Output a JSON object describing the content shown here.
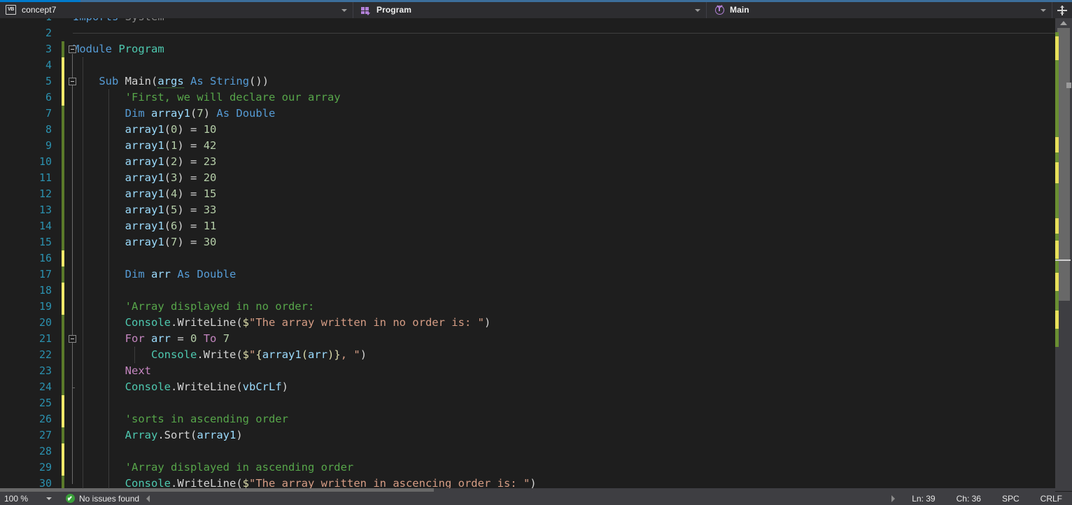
{
  "window": {
    "accent_color": "#007acc",
    "background": "#1e1e1e"
  },
  "nav_bar": {
    "project": {
      "label": "concept7",
      "icon": "vb-file-icon",
      "caret": "chevron-down-icon"
    },
    "type": {
      "label": "Program",
      "icon": "module-icon",
      "caret": "chevron-down-icon"
    },
    "member": {
      "label": "Main",
      "icon": "method-icon",
      "caret": "chevron-down-icon"
    },
    "split_button": "split-view-icon"
  },
  "editor": {
    "language": "Visual Basic",
    "lines": [
      {
        "n": "1",
        "indent": 0,
        "change": "none",
        "fold": "none",
        "text": "Imports System"
      },
      {
        "n": "2",
        "indent": 0,
        "change": "none",
        "fold": "none",
        "text": ""
      },
      {
        "n": "3",
        "indent": 0,
        "change": "saved",
        "fold": "open",
        "text": "Module Program"
      },
      {
        "n": "4",
        "indent": 1,
        "change": "unsaved",
        "fold": "none",
        "text": ""
      },
      {
        "n": "5",
        "indent": 1,
        "change": "unsaved",
        "fold": "open",
        "text": "    Sub Main(args As String())"
      },
      {
        "n": "6",
        "indent": 2,
        "change": "unsaved",
        "fold": "none",
        "text": "        'First, we will declare our array"
      },
      {
        "n": "7",
        "indent": 2,
        "change": "saved",
        "fold": "none",
        "text": "        Dim array1(7) As Double"
      },
      {
        "n": "8",
        "indent": 2,
        "change": "saved",
        "fold": "none",
        "text": "        array1(0) = 10"
      },
      {
        "n": "9",
        "indent": 2,
        "change": "saved",
        "fold": "none",
        "text": "        array1(1) = 42"
      },
      {
        "n": "10",
        "indent": 2,
        "change": "saved",
        "fold": "none",
        "text": "        array1(2) = 23"
      },
      {
        "n": "11",
        "indent": 2,
        "change": "saved",
        "fold": "none",
        "text": "        array1(3) = 20"
      },
      {
        "n": "12",
        "indent": 2,
        "change": "saved",
        "fold": "none",
        "text": "        array1(4) = 15"
      },
      {
        "n": "13",
        "indent": 2,
        "change": "saved",
        "fold": "none",
        "text": "        array1(5) = 33"
      },
      {
        "n": "14",
        "indent": 2,
        "change": "saved",
        "fold": "none",
        "text": "        array1(6) = 11"
      },
      {
        "n": "15",
        "indent": 2,
        "change": "saved",
        "fold": "none",
        "text": "        array1(7) = 30"
      },
      {
        "n": "16",
        "indent": 2,
        "change": "unsaved",
        "fold": "none",
        "text": ""
      },
      {
        "n": "17",
        "indent": 2,
        "change": "saved",
        "fold": "none",
        "text": "        Dim arr As Double"
      },
      {
        "n": "18",
        "indent": 2,
        "change": "unsaved",
        "fold": "none",
        "text": ""
      },
      {
        "n": "19",
        "indent": 2,
        "change": "unsaved",
        "fold": "none",
        "text": "        'Array displayed in no order:"
      },
      {
        "n": "20",
        "indent": 2,
        "change": "saved",
        "fold": "none",
        "text": "        Console.WriteLine($\"The array written in no order is: \")"
      },
      {
        "n": "21",
        "indent": 2,
        "change": "saved",
        "fold": "open",
        "text": "        For arr = 0 To 7"
      },
      {
        "n": "22",
        "indent": 3,
        "change": "saved",
        "fold": "none",
        "text": "            Console.Write($\"{array1(arr)}, \")"
      },
      {
        "n": "23",
        "indent": 2,
        "change": "saved",
        "fold": "none",
        "text": "        Next"
      },
      {
        "n": "24",
        "indent": 2,
        "change": "saved",
        "fold": "endline",
        "text": "        Console.WriteLine(vbCrLf)"
      },
      {
        "n": "25",
        "indent": 2,
        "change": "unsaved",
        "fold": "none",
        "text": ""
      },
      {
        "n": "26",
        "indent": 2,
        "change": "unsaved",
        "fold": "none",
        "text": "        'sorts in ascending order"
      },
      {
        "n": "27",
        "indent": 2,
        "change": "saved",
        "fold": "none",
        "text": "        Array.Sort(array1)"
      },
      {
        "n": "28",
        "indent": 2,
        "change": "unsaved",
        "fold": "none",
        "text": ""
      },
      {
        "n": "29",
        "indent": 2,
        "change": "unsaved",
        "fold": "none",
        "text": "        'Array displayed in ascending order"
      },
      {
        "n": "30",
        "indent": 2,
        "change": "saved",
        "fold": "none",
        "text": "        Console.WriteLine($\"The array written in ascencing order is: \")"
      }
    ],
    "colors": {
      "keyword": "#569cd6",
      "control_keyword": "#c586c0",
      "type": "#4ec9b0",
      "identifier": "#9cdcfe",
      "number": "#b5cea8",
      "string": "#d69d85",
      "comment": "#57a64a",
      "line_number": "#2b91af",
      "plain": "#d4d4d4",
      "unused": "#858585",
      "change_saved": "#5b7a2a",
      "change_unsaved": "#f2e96a"
    }
  },
  "scrollbars": {
    "vertical": {
      "up_arrow": "scroll-up-arrow-icon",
      "thumb_position_pct": 2,
      "thumb_size_pct": 58
    },
    "horizontal": {
      "thumb_size_pct": 41
    }
  },
  "status_bar": {
    "zoom": "100 %",
    "zoom_caret": "chevron-down-icon",
    "issues": "No issues found",
    "issues_icon": "check-circle-icon",
    "collapse_icon": "collapse-left-arrow-icon",
    "expand_icon": "expand-right-arrow-icon",
    "line": "Ln: 39",
    "column": "Ch: 36",
    "indentation": "SPC",
    "line_ending": "CRLF"
  }
}
